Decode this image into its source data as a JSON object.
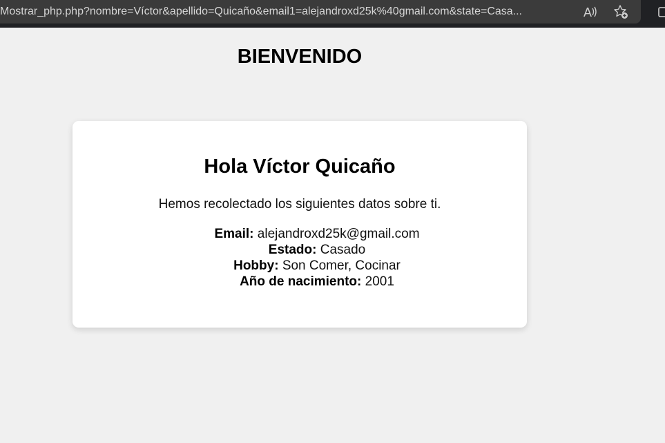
{
  "browser": {
    "url": "Mostrar_php.php?nombre=Víctor&apellido=Quicaño&email1=alejandroxd25k%40gmail.com&state=Casa..."
  },
  "page": {
    "title": "BIENVENIDO"
  },
  "card": {
    "greeting": "Hola Víctor Quicaño",
    "intro": "Hemos recolectado los siguientes datos sobre ti.",
    "details": [
      {
        "label": "Email:",
        "value": "alejandroxd25k@gmail.com"
      },
      {
        "label": "Estado:",
        "value": "Casado"
      },
      {
        "label": "Hobby:",
        "value": "Son Comer, Cocinar"
      },
      {
        "label": "Año de nacimiento:",
        "value": "2001"
      }
    ]
  },
  "icons": {
    "read_aloud": "read-aloud-icon",
    "add_favorite": "add-favorite-icon",
    "tab_action": "tab-action-icon"
  },
  "colors": {
    "page_background": "#f0f0f0",
    "card_background": "#ffffff",
    "browser_bar": "#202124",
    "url_field": "#3b3b3b"
  }
}
